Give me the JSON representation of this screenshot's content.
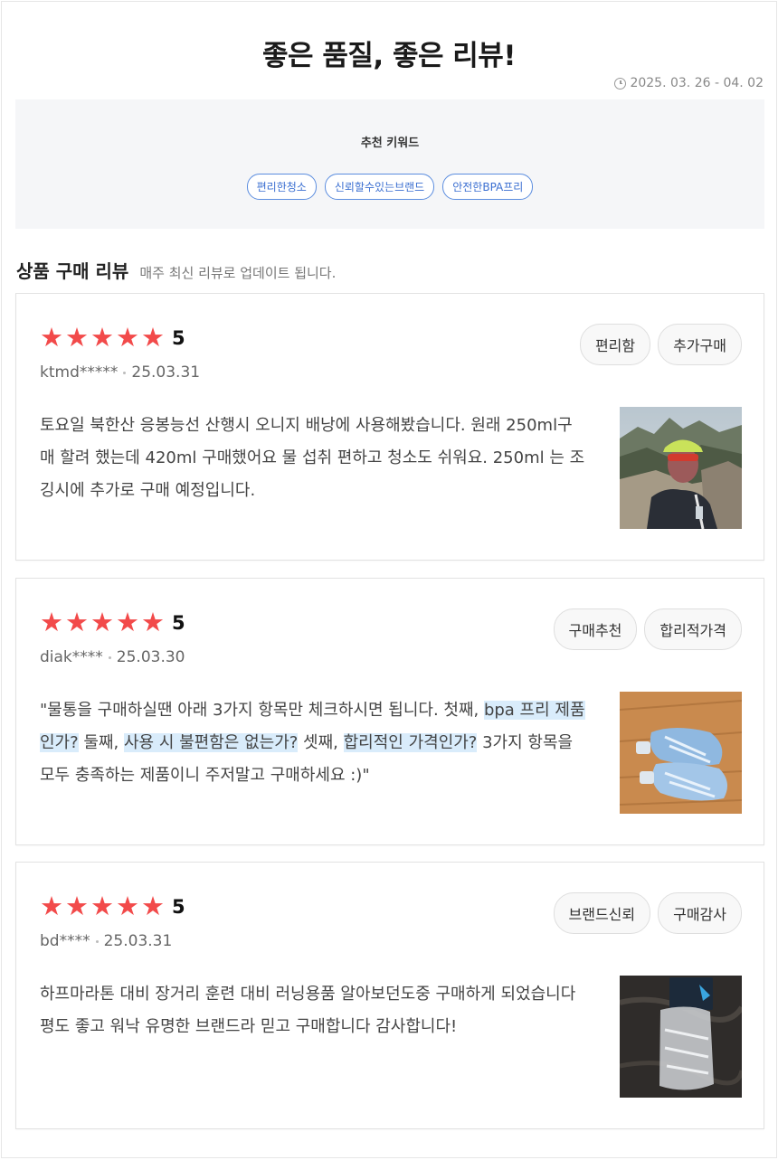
{
  "header": {
    "title": "좋은 품질, 좋은 리뷰!",
    "date_range": "2025. 03. 26 - 04. 02"
  },
  "keywords": {
    "title": "추천 키워드",
    "items": [
      "편리한청소",
      "신뢰할수있는브랜드",
      "안전한BPA프리"
    ]
  },
  "section": {
    "title": "상품 구매 리뷰",
    "subtitle": "매주 최신 리뷰로 업데이트 됩니다."
  },
  "reviews": [
    {
      "rating": "5",
      "stars": 5,
      "user": "ktmd*****",
      "date": "25.03.31",
      "tags": [
        "편리함",
        "추가구매"
      ],
      "text": "토요일 북한산 응봉능선 산행시 오니지 배낭에 사용해봤습니다. 원래 250ml구매 할려 했는데 420ml 구매했어요 물 섭취 편하고 청소도 쉬워요. 250ml 는 조깅시에 추가로 구매 예정입니다.",
      "photo_icon": "hiker-photo"
    },
    {
      "rating": "5",
      "stars": 5,
      "user": "diak****",
      "date": "25.03.30",
      "tags": [
        "구매추천",
        "합리적가격"
      ],
      "text_parts": [
        "\"물통을 구매하실땐 아래 3가지 항목만 체크하시면 됩니다. 첫째, ",
        "bpa 프리 제품인가?",
        " 둘째, ",
        "사용 시 불편함은 없는가?",
        " 셋째, ",
        "합리적인 가격인가?",
        " 3가지 항목을 모두 충족하는 제품이니 주저말고 구매하세요 :)\""
      ],
      "photo_icon": "bottles-photo"
    },
    {
      "rating": "5",
      "stars": 5,
      "user": "bd****",
      "date": "25.03.31",
      "tags": [
        "브랜드신뢰",
        "구매감사"
      ],
      "text": "하프마라톤 대비 장거리 훈련 대비 러닝용품 알아보던도중 구매하게 되었습니다 평도 좋고 워낙 유명한 브랜드라 믿고 구매합니다 감사합니다!",
      "photo_icon": "product-package-photo"
    }
  ],
  "colors": {
    "star": "#f24a4a",
    "keyword_chip": "#3b6fd1",
    "highlight": "#d9ecfb"
  }
}
